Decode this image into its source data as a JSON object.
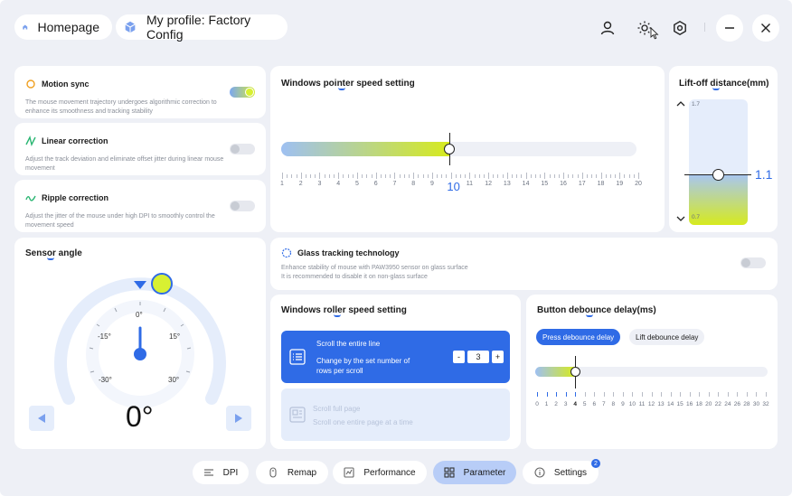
{
  "header": {
    "home_label": "Homepage",
    "profile_label": "My profile: Factory Config"
  },
  "features": [
    {
      "title": "Motion sync",
      "desc": "The mouse movement trajectory undergoes algorithmic correction to enhance its smoothness and tracking stability",
      "enabled": true
    },
    {
      "title": "Linear correction",
      "desc": "Adjust the track deviation and eliminate offset jitter during linear mouse movement",
      "enabled": false
    },
    {
      "title": "Ripple correction",
      "desc": "Adjust the jitter of the mouse under high DPI to smoothly control the movement speed",
      "enabled": false
    }
  ],
  "pointer_speed": {
    "title": "Windows pointer speed setting",
    "value": "10",
    "fraction": 0.474,
    "tick_labels": [
      "1",
      "2",
      "3",
      "4",
      "5",
      "6",
      "7",
      "8",
      "9",
      "",
      "11",
      "12",
      "13",
      "14",
      "15",
      "16",
      "17",
      "18",
      "19",
      "20"
    ]
  },
  "liftoff": {
    "title": "Lift-off distance(mm)",
    "max_label": "1.7",
    "min_label": "0.7",
    "value": "1.1",
    "fraction": 0.4
  },
  "sensor": {
    "title": "Sensor angle",
    "value": "0°",
    "dial_labels": {
      "top": "0°",
      "left15": "-15°",
      "right15": "15°",
      "left30": "-30°",
      "right30": "30°"
    }
  },
  "glass": {
    "title": "Glass tracking technology",
    "desc1": "Enhance stability of mouse with PAW3950 sensor on glass surface",
    "desc2": "It is recommended to disable it on non-glass surface",
    "enabled": false
  },
  "roller": {
    "title": "Windows roller speed setting",
    "option1_title": "Scroll the entire line",
    "option1_desc": "Change by the set number of rows per scroll",
    "rows_value": "3",
    "minus": "-",
    "plus": "+",
    "option2_title": "Scroll full page",
    "option2_desc": "Scroll one entire page at a time"
  },
  "debounce": {
    "title": "Button debounce delay(ms)",
    "tab_press": "Press debounce delay",
    "tab_lift": "Lift debounce delay",
    "value": "4",
    "tick_labels": [
      "0",
      "1",
      "2",
      "3",
      "4",
      "5",
      "6",
      "7",
      "8",
      "9",
      "10",
      "11",
      "12",
      "13",
      "14",
      "15",
      "16",
      "18",
      "20",
      "22",
      "24",
      "26",
      "28",
      "30",
      "32"
    ]
  },
  "nav": {
    "dpi": "DPI",
    "remap": "Remap",
    "performance": "Performance",
    "parameter": "Parameter",
    "settings": "Settings",
    "settings_badge": "2"
  },
  "colors": {
    "accent": "#2f6be6",
    "lime": "#d8f032",
    "active_nav": "#b8cdf7"
  }
}
